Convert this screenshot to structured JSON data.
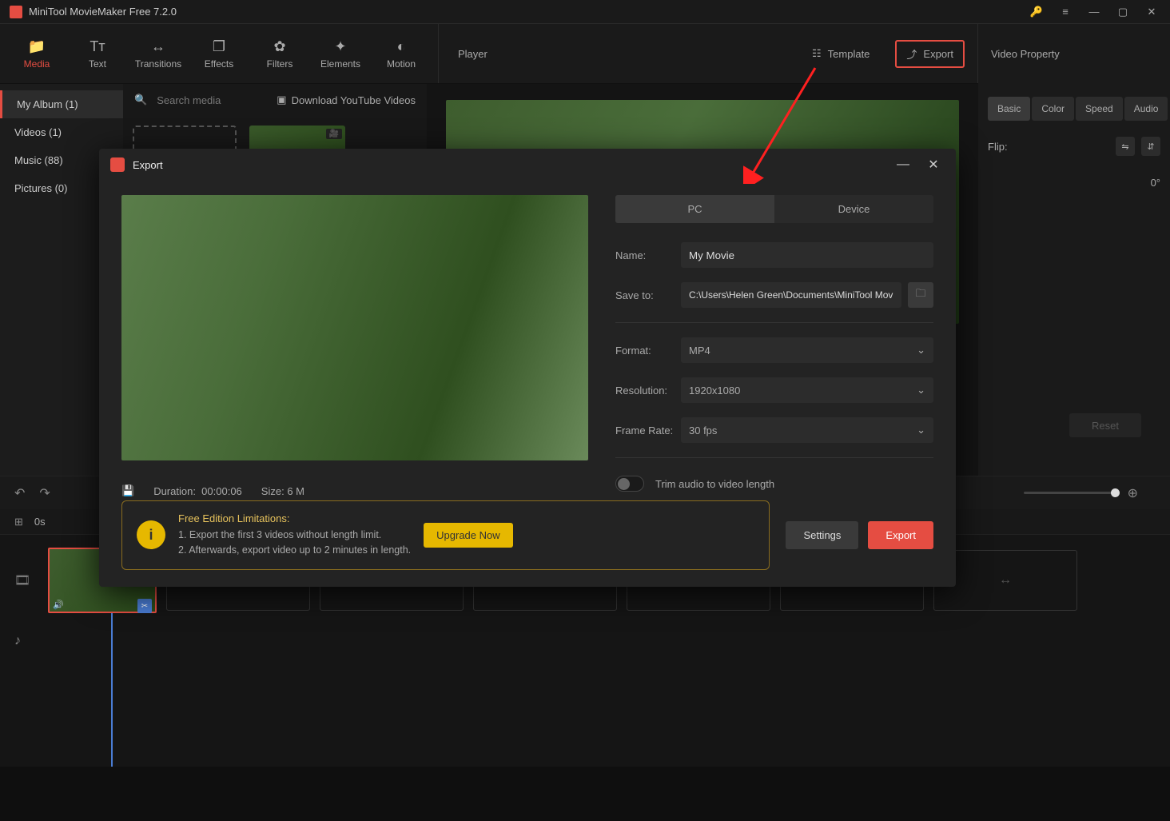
{
  "app": {
    "title": "MiniTool MovieMaker Free 7.2.0"
  },
  "toolbar": {
    "media": "Media",
    "text": "Text",
    "transitions": "Transitions",
    "effects": "Effects",
    "filters": "Filters",
    "elements": "Elements",
    "motion": "Motion"
  },
  "top": {
    "player": "Player",
    "template": "Template",
    "export": "Export",
    "video_property": "Video Property"
  },
  "sidebar": {
    "items": [
      "My Album (1)",
      "Videos (1)",
      "Music (88)",
      "Pictures (0)"
    ]
  },
  "media": {
    "search_placeholder": "Search media",
    "download_btn": "Download YouTube Videos"
  },
  "props": {
    "tabs": {
      "basic": "Basic",
      "color": "Color",
      "speed": "Speed",
      "audio": "Audio"
    },
    "flip_label": "Flip:",
    "rotate_value": "0°",
    "reset": "Reset"
  },
  "timeline": {
    "time": "0s"
  },
  "export_modal": {
    "title": "Export",
    "tabs": {
      "pc": "PC",
      "device": "Device"
    },
    "name_label": "Name:",
    "name_value": "My Movie",
    "saveto_label": "Save to:",
    "saveto_value": "C:\\Users\\Helen Green\\Documents\\MiniTool MovieM",
    "format_label": "Format:",
    "format_value": "MP4",
    "resolution_label": "Resolution:",
    "resolution_value": "1920x1080",
    "framerate_label": "Frame Rate:",
    "framerate_value": "30 fps",
    "trim_label": "Trim audio to video length",
    "duration_label": "Duration:",
    "duration_value": "00:00:06",
    "size_label": "Size:",
    "size_value": "6 M",
    "limit_title": "Free Edition Limitations:",
    "limit_line1": "1. Export the first 3 videos without length limit.",
    "limit_line2": "2. Afterwards, export video up to 2 minutes in length.",
    "upgrade": "Upgrade Now",
    "settings": "Settings",
    "export": "Export"
  }
}
